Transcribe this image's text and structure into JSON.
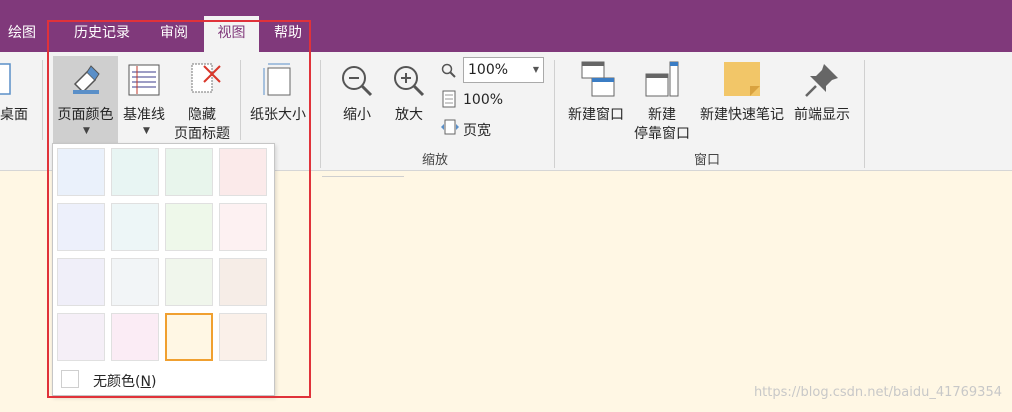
{
  "tabs": [
    {
      "label": "绘图",
      "active": false
    },
    {
      "label": "历史记录",
      "active": false
    },
    {
      "label": "审阅",
      "active": false
    },
    {
      "label": "视图",
      "active": true
    },
    {
      "label": "帮助",
      "active": false
    }
  ],
  "ribbon": {
    "desktop_label": "桌面",
    "page_color_label": "页面颜色",
    "rule_lines_label": "基准线",
    "hide_title_line1": "隐藏",
    "hide_title_line2": "页面标题",
    "paper_size_label": "纸张大小",
    "zoom_out_label": "缩小",
    "zoom_in_label": "放大",
    "zoom_value": "100%",
    "zoom_100_label": "100%",
    "page_width_label": "页宽",
    "zoom_group_label": "缩放",
    "new_window_label": "新建窗口",
    "new_docked_line1": "新建",
    "new_docked_line2": "停靠窗口",
    "quick_note_label": "新建快速笔记",
    "always_on_top_label": "前端显示",
    "window_group_label": "窗口"
  },
  "palette": {
    "swatches": [
      [
        "#eaf1fb",
        "#e8f5f3",
        "#e8f5ec",
        "#fbeaea"
      ],
      [
        "#edf0fb",
        "#edf6f7",
        "#eef8ea",
        "#fdf1f2"
      ],
      [
        "#f0eff9",
        "#f2f5f7",
        "#f0f6ec",
        "#f6ede7"
      ],
      [
        "#f5eff7",
        "#fbecf5",
        "#fff7e4",
        "#faf0e9"
      ]
    ],
    "selected_index": [
      3,
      2
    ],
    "no_color_prefix": "无颜色(",
    "no_color_key": "N",
    "no_color_suffix": ")"
  },
  "watermark": "https://blog.csdn.net/baidu_41769354",
  "colors": {
    "accent": "#80397b",
    "highlight": "#e0323a",
    "selected": "#f0a030"
  }
}
